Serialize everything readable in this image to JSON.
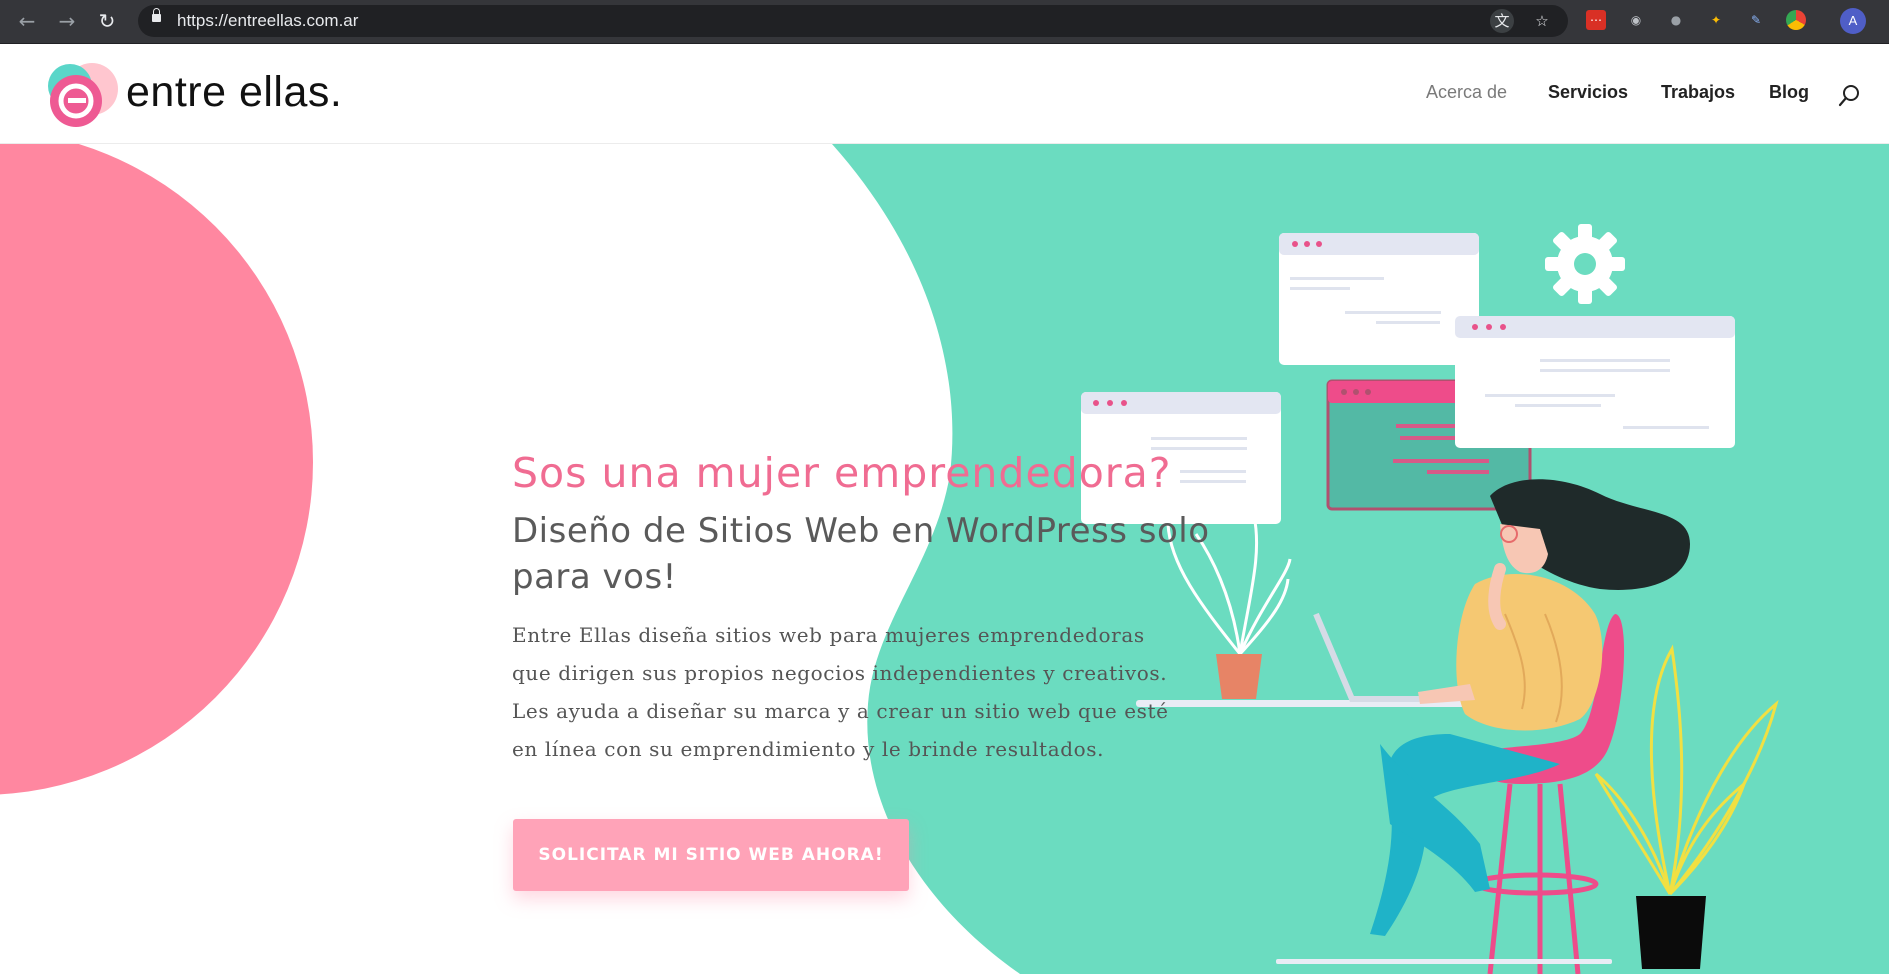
{
  "browser": {
    "url": "https://entreellas.com.ar",
    "avatar_initial": "A",
    "icons": [
      "back-icon",
      "forward-icon",
      "reload-icon",
      "lock-icon",
      "translate-icon",
      "star-icon",
      "extension-icons"
    ]
  },
  "site": {
    "logo_text": "entre ellas.",
    "nav": [
      {
        "label": "Acerca de",
        "active": true
      },
      {
        "label": "Servicios",
        "active": false
      },
      {
        "label": "Trabajos",
        "active": false
      },
      {
        "label": "Blog",
        "active": false
      }
    ]
  },
  "hero": {
    "headline": "Sos una mujer emprendedora?",
    "subhead": "Diseño de Sitios Web en WordPress solo para vos!",
    "body": "Entre Ellas diseña sitios web para mujeres emprendedoras que dirigen sus propios negocios independientes y creativos. Les ayuda a diseñar su marca y a crear un sitio web que esté en línea con su emprendimiento y le brinde resultados.",
    "cta_label": "SOLICITAR MI SITIO WEB AHORA!"
  },
  "colors": {
    "pink": "#ff87a0",
    "mint": "#6bdcc0",
    "headline_pink": "#f06c92",
    "cta": "#ffa3b8"
  }
}
